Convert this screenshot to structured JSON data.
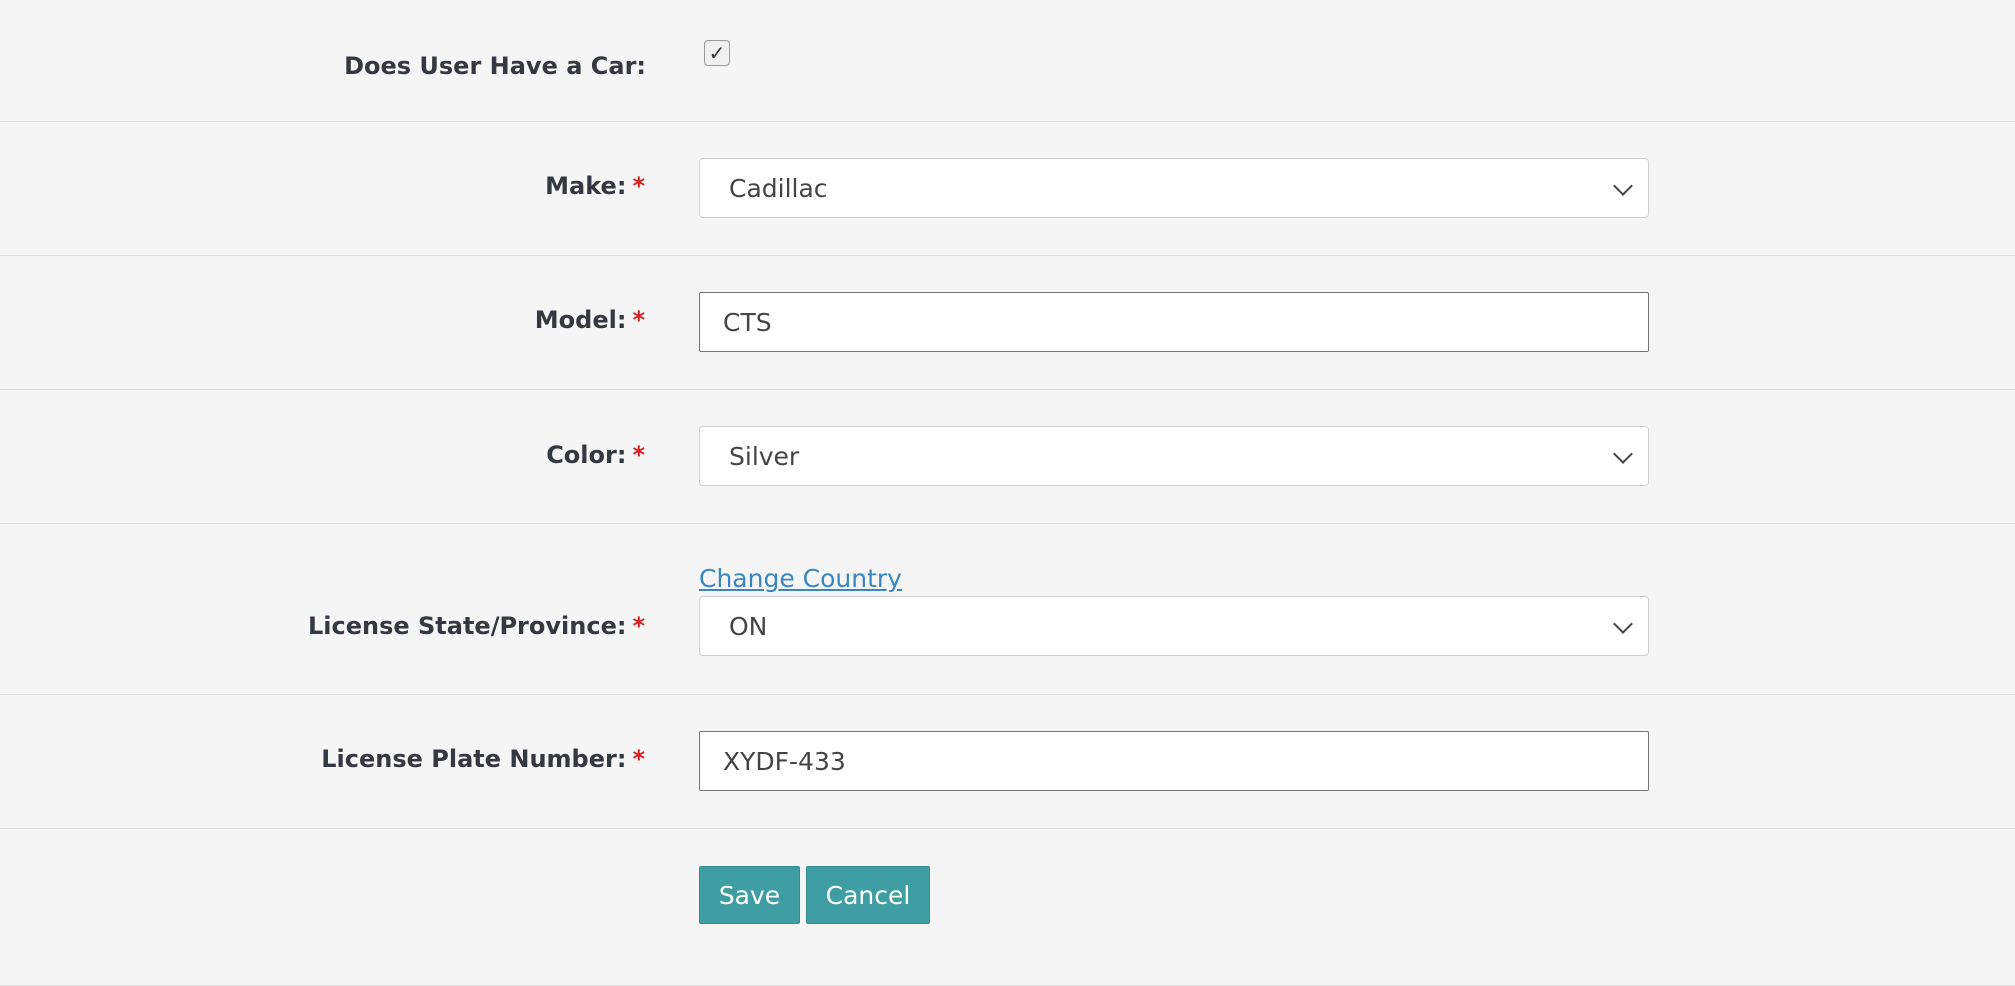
{
  "form": {
    "has_car": {
      "label": "Does User Have a Car:",
      "checked": true,
      "check_glyph": "✓"
    },
    "make": {
      "label": "Make:",
      "required_mark": "*",
      "value": "Cadillac"
    },
    "model": {
      "label": "Model:",
      "required_mark": "*",
      "value": "CTS"
    },
    "color": {
      "label": "Color:",
      "required_mark": "*",
      "value": "Silver"
    },
    "license_state": {
      "label": "License State/Province:",
      "required_mark": "*",
      "change_country_link": "Change Country",
      "value": "ON"
    },
    "license_plate": {
      "label": "License Plate Number:",
      "required_mark": "*",
      "value": "XYDF-433"
    },
    "actions": {
      "save_label": "Save",
      "cancel_label": "Cancel"
    }
  },
  "colors": {
    "background": "#f5f5f5",
    "required": "#d81f1f",
    "link": "#3a86bf",
    "button": "#3f9ea4"
  }
}
